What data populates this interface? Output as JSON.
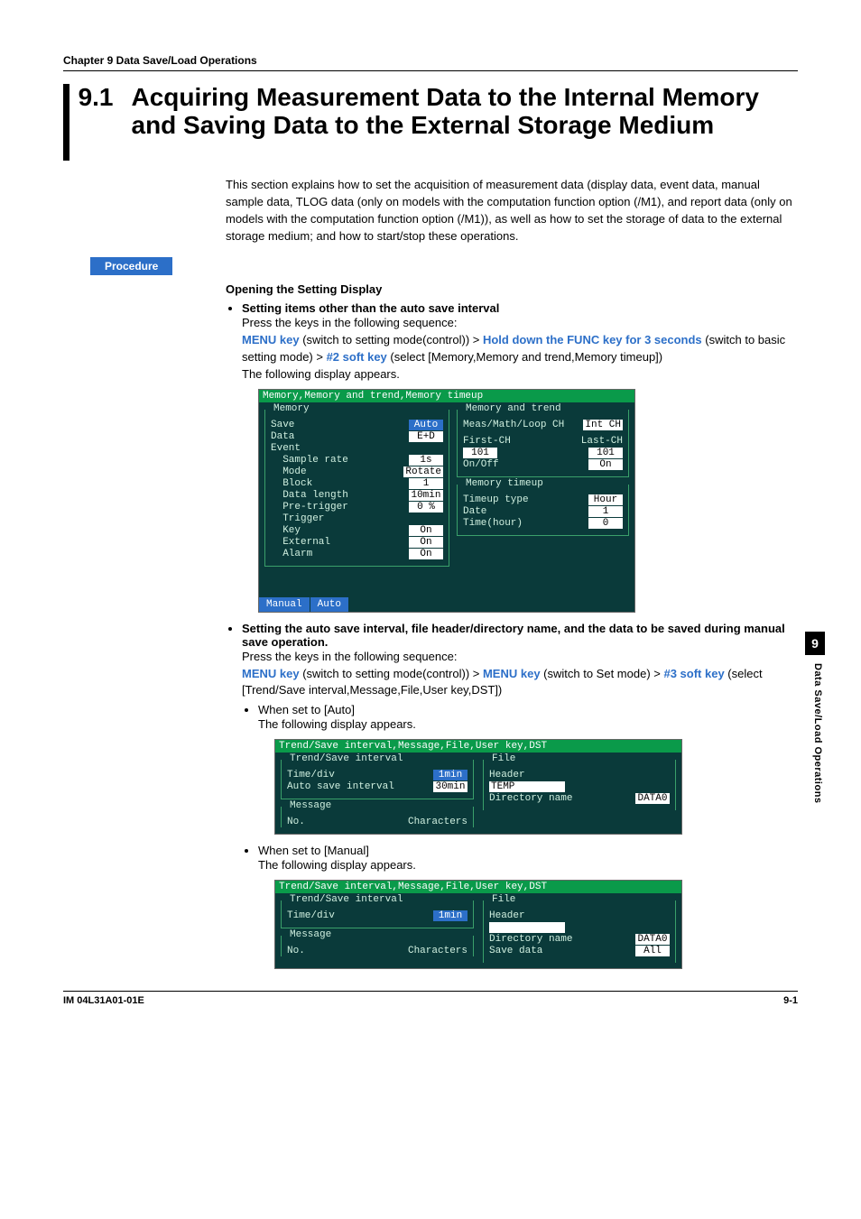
{
  "chapter_header": "Chapter 9   Data Save/Load Operations",
  "section_number": "9.1",
  "section_title": "Acquiring Measurement Data to the Internal Memory and Saving Data to the External Storage Medium",
  "intro": "This section explains how to set the acquisition of measurement data (display data, event data, manual sample data, TLOG data (only on models with the computation function option (/M1), and report data (only on models with the computation function option (/M1)), as well as how to set the storage of data to the external storage medium; and how to start/stop these operations.",
  "procedure_label": "Procedure",
  "opening_hdr": "Opening the Setting Display",
  "b1_bold": "Setting items other than the auto save interval",
  "press_keys": "Press the keys in the following sequence:",
  "menu_key": "MENU key",
  "menu_key_after": " (switch to setting mode(control)) > ",
  "hold_func": "Hold down the FUNC key for 3 seconds",
  "hold_func_after": " (switch to basic setting mode) > ",
  "soft2": "#2 soft key",
  "soft2_after": " (select [Memory,Memory and trend,Memory timeup])",
  "following_appears": "The following display appears.",
  "scr1": {
    "title": "Memory,Memory and trend,Memory timeup",
    "memory_legend": "Memory",
    "mem_rows": {
      "Save": "Auto",
      "Data": "E+D",
      "Event": "",
      "SampleRateLabel": "  Sample rate",
      "SampleRate": "1s",
      "Mode": "Rotate",
      "Block": "1",
      "DataLength": "10min",
      "PreTrigger": "0  %",
      "Trigger": "",
      "KeyLabel": "  Key",
      "Key": "On",
      "ExternalLabel": "  External",
      "External": "On",
      "AlarmLabel": "  Alarm",
      "Alarm": "On"
    },
    "mat_legend": "Memory and trend",
    "mat_rows": {
      "MeasMath": "Meas/Math/Loop CH",
      "MeasMathVal": "Int CH",
      "FirstCH": "First-CH",
      "LastCH": "Last-CH",
      "FirstVal": "101",
      "LastVal": "101",
      "OnOff": "On/Off",
      "OnOffVal": "On"
    },
    "timeup_legend": "Memory timeup",
    "timeup_rows": {
      "TimeupTypeLabel": "Timeup type",
      "TimeupType": "Hour",
      "DateLabel": "Date",
      "Date": "1",
      "TimeLabel": "Time(hour)",
      "Time": "0"
    },
    "btn_manual": "Manual",
    "btn_auto": "Auto"
  },
  "b2_bold": "Setting the auto save interval, file header/directory name, and the data to be saved during manual save operation.",
  "menu_key2_after": " (switch to Set mode) > ",
  "soft3": "#3 soft key",
  "soft3_after": " (select [Trend/Save interval,Message,File,User key,DST])",
  "when_auto": "When set to [Auto]",
  "when_manual": "When set to [Manual]",
  "scr2": {
    "title": "Trend/Save interval,Message,File,User key,DST",
    "tsi_legend": "Trend/Save interval",
    "timediv_label": "Time/div",
    "timediv_val": "1min",
    "autosave_label": "Auto save interval",
    "autosave_val": "30min",
    "msg_legend": "Message",
    "msg_no": "No.",
    "msg_chars": "Characters",
    "file_legend": "File",
    "header_label": "Header",
    "header_val": "TEMP",
    "dir_label": "Directory name",
    "dir_val": "DATA0"
  },
  "scr3": {
    "title": "Trend/Save interval,Message,File,User key,DST",
    "tsi_legend": "Trend/Save interval",
    "timediv_label": "Time/div",
    "timediv_val": "1min",
    "msg_legend": "Message",
    "msg_no": "No.",
    "msg_chars": "Characters",
    "file_legend": "File",
    "header_label": "Header",
    "header_val": "",
    "dir_label": "Directory name",
    "dir_val": "DATA0",
    "savedata_label": "Save data",
    "savedata_val": "All"
  },
  "side_chapter": "9",
  "side_text": "Data Save/Load Operations",
  "footer_left": "IM 04L31A01-01E",
  "footer_right": "9-1"
}
